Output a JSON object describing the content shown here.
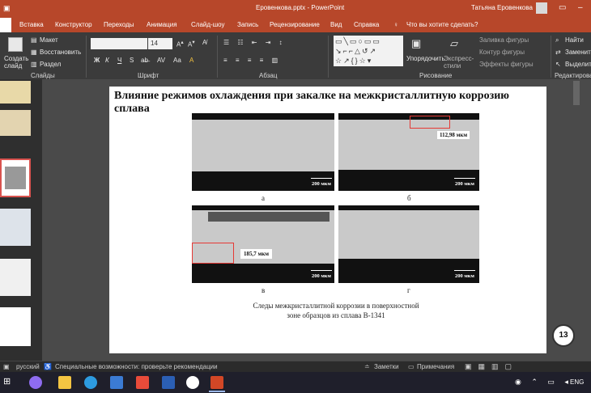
{
  "titlebar": {
    "filename": "Еровенкова.pptx - PowerPoint",
    "user": "Татьяна Еровенкова"
  },
  "tabs": [
    "Вставка",
    "Конструктор",
    "Переходы",
    "Анимация",
    "Слайд-шоу",
    "Запись",
    "Рецензирование",
    "Вид",
    "Справка"
  ],
  "tell_me": "Что вы хотите сделать?",
  "ribbon": {
    "slides_group": {
      "new_slide": "Создать слайд",
      "layout": "Макет",
      "reset": "Восстановить",
      "section": "Раздел",
      "label": "Слайды"
    },
    "font_group": {
      "font_size": "14",
      "bold": "Ж",
      "italic": "К",
      "underline": "Ч",
      "strike": "S",
      "label": "Шрифт"
    },
    "paragraph_group": {
      "label": "Абзац"
    },
    "drawing_group": {
      "arrange": "Упорядочить",
      "quick_styles": "Экспресс-стили",
      "fill": "Заливка фигуры",
      "outline": "Контур фигуры",
      "effects": "Эффекты фигуры",
      "label": "Рисование"
    },
    "editing_group": {
      "find": "Найти",
      "replace": "Заменить",
      "select": "Выделить",
      "label": "Редактирова"
    }
  },
  "slide": {
    "title": "Влияние режимов охлаждения при закалке на межкристаллитную коррозию сплава",
    "panels": [
      {
        "letter": "а",
        "scale": "200 мкм"
      },
      {
        "letter": "б",
        "scale": "200 мкм",
        "measure": "112,98 мкм"
      },
      {
        "letter": "в",
        "scale": "200 мкм",
        "measure": "185,7 мкм"
      },
      {
        "letter": "г",
        "scale": "200 мкм"
      }
    ],
    "caption": "Следы межкристаллитной коррозии в поверхностной зоне образцов из сплава В-1341",
    "page_number": "13"
  },
  "statusbar": {
    "language": "русский",
    "accessibility": "Специальные возможности: проверьте рекомендации",
    "notes": "Заметки",
    "comments": "Примечания"
  },
  "taskbar": {
    "lang": "ENG"
  }
}
